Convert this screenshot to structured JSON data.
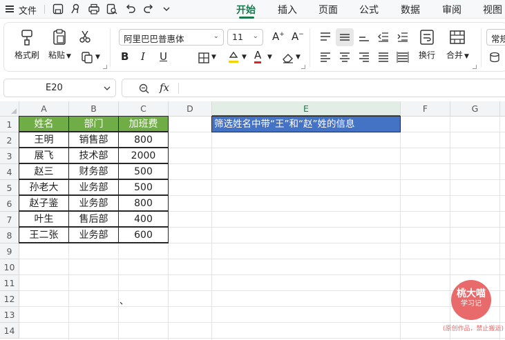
{
  "menu": {
    "file_label": "文件"
  },
  "tabs": [
    {
      "label": "开始",
      "active": true
    },
    {
      "label": "插入",
      "active": false
    },
    {
      "label": "页面",
      "active": false
    },
    {
      "label": "公式",
      "active": false
    },
    {
      "label": "数据",
      "active": false
    },
    {
      "label": "审阅",
      "active": false
    },
    {
      "label": "视图",
      "active": false
    }
  ],
  "ribbon": {
    "format_painter": "格式刷",
    "paste": "粘贴",
    "font_name": "阿里巴巴普惠体",
    "font_size": "11",
    "wrap": "换行",
    "merge": "合并",
    "number_format": "常规"
  },
  "formula_bar": {
    "name_box": "E20",
    "fx": "fx",
    "content": ""
  },
  "sheet": {
    "columns": [
      "A",
      "B",
      "C",
      "D",
      "E",
      "F",
      "G"
    ],
    "rows": [
      "1",
      "2",
      "3",
      "4",
      "5",
      "6",
      "7",
      "8",
      "9",
      "10",
      "11",
      "12",
      "13",
      "14"
    ],
    "selected_column": "E",
    "headers": [
      "姓名",
      "部门",
      "加班费"
    ],
    "data": [
      [
        "王明",
        "销售部",
        "800"
      ],
      [
        "展飞",
        "技术部",
        "2000"
      ],
      [
        "赵三",
        "财务部",
        "500"
      ],
      [
        "孙老大",
        "业务部",
        "500"
      ],
      [
        "赵子鉴",
        "业务部",
        "800"
      ],
      [
        "叶生",
        "售后部",
        "400"
      ],
      [
        "王二张",
        "业务部",
        "600"
      ]
    ],
    "e1_text": "筛选姓名中带“王”和“赵”姓的信息",
    "e1_fill": "#4472c4",
    "header_fill": "#70ad47",
    "stray_mark": "、"
  },
  "watermark": {
    "line1": "桃大喵",
    "line2": "学习记",
    "caption": "(原创作品，禁止搬运)",
    "color": "#e86a6a"
  },
  "colors": {
    "accent": "#1a7a4d"
  }
}
